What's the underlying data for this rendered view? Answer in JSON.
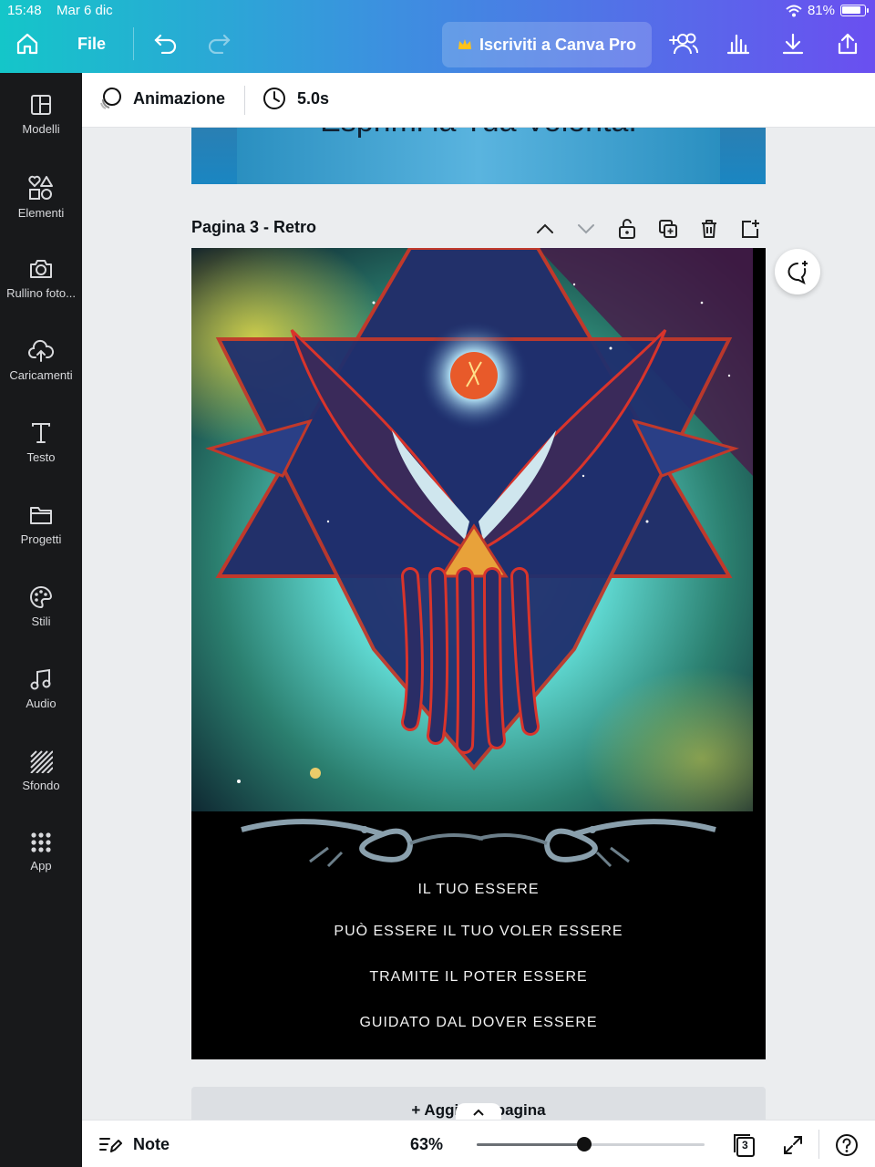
{
  "status": {
    "time": "15:48",
    "date": "Mar 6 dic",
    "battery": "81%"
  },
  "topbar": {
    "file_label": "File",
    "pro_label": "Iscriviti a Canva Pro"
  },
  "sidebar": {
    "items": [
      {
        "label": "Modelli",
        "icon": "layout-icon"
      },
      {
        "label": "Elementi",
        "icon": "shapes-icon"
      },
      {
        "label": "Rullino foto...",
        "icon": "camera-icon"
      },
      {
        "label": "Caricamenti",
        "icon": "cloud-upload-icon"
      },
      {
        "label": "Testo",
        "icon": "text-icon"
      },
      {
        "label": "Progetti",
        "icon": "folder-icon"
      },
      {
        "label": "Stili",
        "icon": "palette-icon"
      },
      {
        "label": "Audio",
        "icon": "music-icon"
      },
      {
        "label": "Sfondo",
        "icon": "pattern-icon"
      },
      {
        "label": "App",
        "icon": "grid-icon"
      }
    ]
  },
  "toolbar": {
    "animation_label": "Animazione",
    "duration": "5.0s"
  },
  "canvas": {
    "prev_page_clip_text": "Esprimi la Tua Volontà.",
    "page_title": "Pagina 3 - Retro",
    "lines": [
      "IL TUO ESSERE",
      "PUÒ ESSERE IL TUO VOLER ESSERE",
      "TRAMITE IL POTER ESSERE",
      "GUIDATO DAL DOVER ESSERE"
    ],
    "add_page_label": "+ Aggiungi pagina"
  },
  "bottombar": {
    "notes_label": "Note",
    "zoom": "63%",
    "zoom_level": 0.47,
    "page_count": "3"
  },
  "colors": {
    "sidebar_bg": "#18191b",
    "accent_start": "#14c6c9",
    "accent_end": "#6a4ff0"
  }
}
